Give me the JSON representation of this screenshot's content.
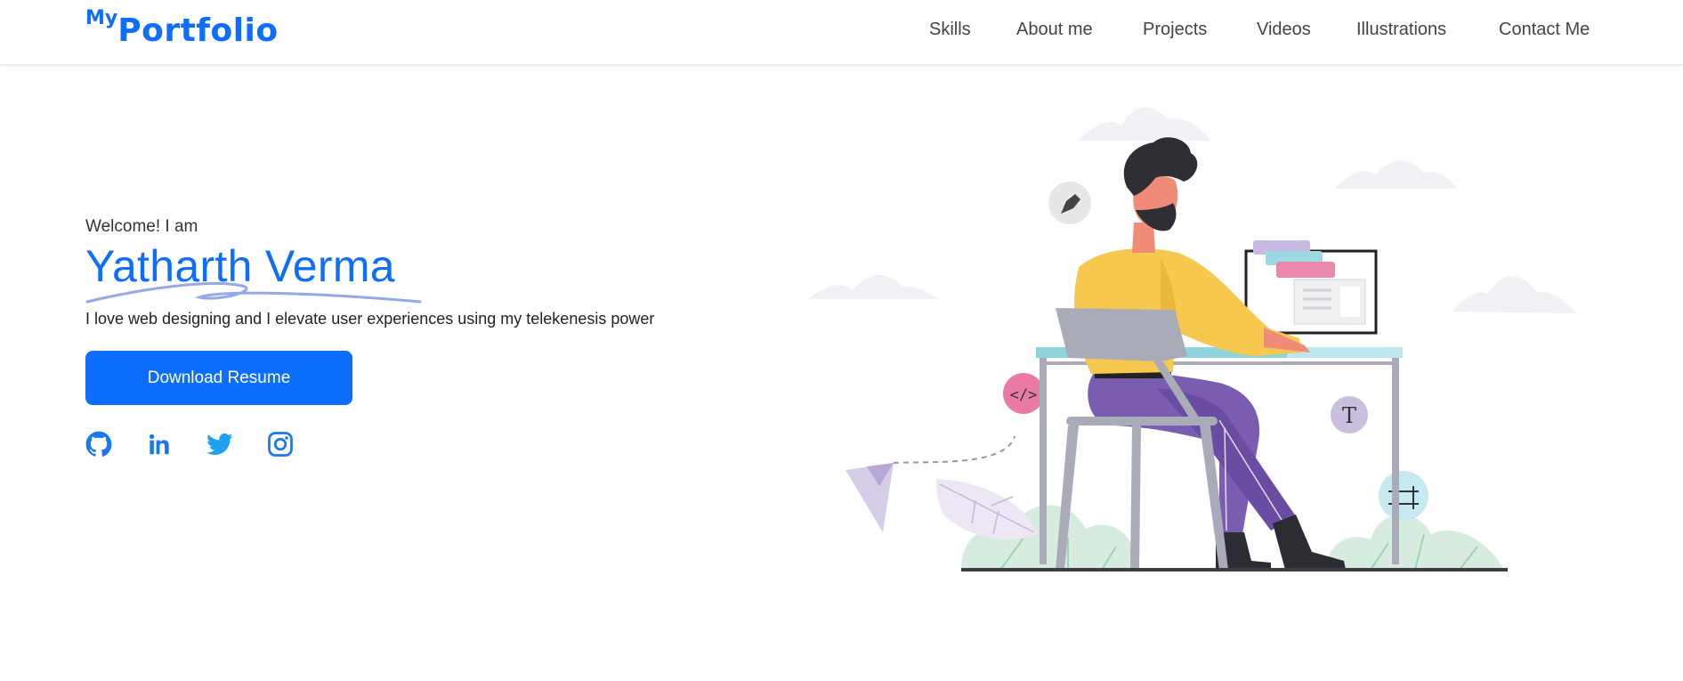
{
  "nav": {
    "logo_prefix": "My",
    "logo_main": "Portfolio",
    "links": [
      "Skills",
      "About me",
      "Projects",
      "Videos",
      "Illustrations",
      "Contact Me"
    ]
  },
  "hero": {
    "welcome": "Welcome! I am",
    "name": "Yatharth Verma",
    "tagline": "I love web designing and I elevate user experiences using my telekenesis power",
    "resume_button": "Download Resume",
    "socials": [
      "github-icon",
      "linkedin-icon",
      "twitter-icon",
      "instagram-icon"
    ]
  },
  "illustration": {
    "code_badge": "</>",
    "type_badge": "T"
  },
  "colors": {
    "accent": "#0d6efd",
    "nav_text": "#444444",
    "shirt": "#f6c94e",
    "pants": "#7a5cb0",
    "chair": "#a9acb8",
    "desk_top": "#8fd3dc"
  }
}
